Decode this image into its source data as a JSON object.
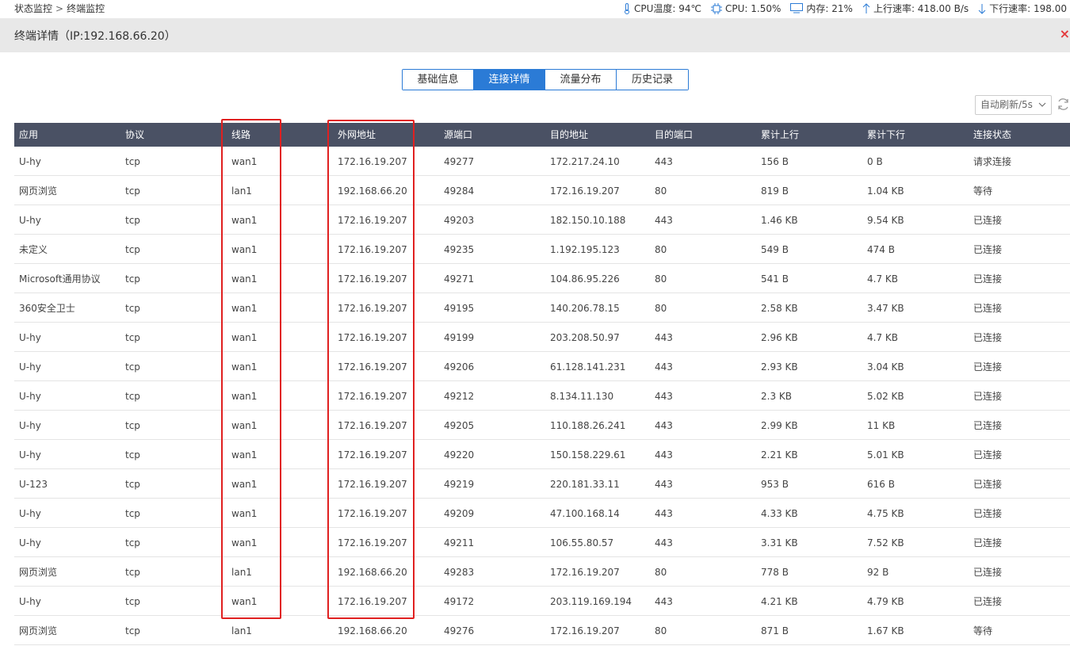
{
  "breadcrumb": {
    "parent": "状态监控",
    "separator": ">",
    "current": "终端监控"
  },
  "stats": {
    "cpu_temp": "CPU温度: 94℃",
    "cpu": "CPU: 1.50%",
    "memory": "内存: 21%",
    "upload": "上行速率: 418.00 B/s",
    "download": "下行速率: 198.00"
  },
  "panel": {
    "title": "终端详情（IP:192.168.66.20）",
    "close": "×"
  },
  "tabs": [
    {
      "label": "基础信息",
      "active": false
    },
    {
      "label": "连接详情",
      "active": true
    },
    {
      "label": "流量分布",
      "active": false
    },
    {
      "label": "历史记录",
      "active": false
    }
  ],
  "refresh": {
    "value": "自动刷新/5s"
  },
  "table": {
    "headers": [
      "应用",
      "协议",
      "线路",
      "外网地址",
      "源端口",
      "目的地址",
      "目的端口",
      "累计上行",
      "累计下行",
      "连接状态"
    ],
    "rows": [
      [
        "U-hy",
        "tcp",
        "wan1",
        "172.16.19.207",
        "49277",
        "172.217.24.10",
        "443",
        "156 B",
        "0 B",
        "请求连接"
      ],
      [
        "网页浏览",
        "tcp",
        "lan1",
        "192.168.66.20",
        "49284",
        "172.16.19.207",
        "80",
        "819 B",
        "1.04 KB",
        "等待"
      ],
      [
        "U-hy",
        "tcp",
        "wan1",
        "172.16.19.207",
        "49203",
        "182.150.10.188",
        "443",
        "1.46 KB",
        "9.54 KB",
        "已连接"
      ],
      [
        "未定义",
        "tcp",
        "wan1",
        "172.16.19.207",
        "49235",
        "1.192.195.123",
        "80",
        "549 B",
        "474 B",
        "已连接"
      ],
      [
        "Microsoft通用协议",
        "tcp",
        "wan1",
        "172.16.19.207",
        "49271",
        "104.86.95.226",
        "80",
        "541 B",
        "4.7 KB",
        "已连接"
      ],
      [
        "360安全卫士",
        "tcp",
        "wan1",
        "172.16.19.207",
        "49195",
        "140.206.78.15",
        "80",
        "2.58 KB",
        "3.47 KB",
        "已连接"
      ],
      [
        "U-hy",
        "tcp",
        "wan1",
        "172.16.19.207",
        "49199",
        "203.208.50.97",
        "443",
        "2.96 KB",
        "4.7 KB",
        "已连接"
      ],
      [
        "U-hy",
        "tcp",
        "wan1",
        "172.16.19.207",
        "49206",
        "61.128.141.231",
        "443",
        "2.93 KB",
        "3.04 KB",
        "已连接"
      ],
      [
        "U-hy",
        "tcp",
        "wan1",
        "172.16.19.207",
        "49212",
        "8.134.11.130",
        "443",
        "2.3 KB",
        "5.02 KB",
        "已连接"
      ],
      [
        "U-hy",
        "tcp",
        "wan1",
        "172.16.19.207",
        "49205",
        "110.188.26.241",
        "443",
        "2.99 KB",
        "11 KB",
        "已连接"
      ],
      [
        "U-hy",
        "tcp",
        "wan1",
        "172.16.19.207",
        "49220",
        "150.158.229.61",
        "443",
        "2.21 KB",
        "5.01 KB",
        "已连接"
      ],
      [
        "U-123",
        "tcp",
        "wan1",
        "172.16.19.207",
        "49219",
        "220.181.33.11",
        "443",
        "953 B",
        "616 B",
        "已连接"
      ],
      [
        "U-hy",
        "tcp",
        "wan1",
        "172.16.19.207",
        "49209",
        "47.100.168.14",
        "443",
        "4.33 KB",
        "4.75 KB",
        "已连接"
      ],
      [
        "U-hy",
        "tcp",
        "wan1",
        "172.16.19.207",
        "49211",
        "106.55.80.57",
        "443",
        "3.31 KB",
        "7.52 KB",
        "已连接"
      ],
      [
        "网页浏览",
        "tcp",
        "lan1",
        "192.168.66.20",
        "49283",
        "172.16.19.207",
        "80",
        "778 B",
        "92 B",
        "已连接"
      ],
      [
        "U-hy",
        "tcp",
        "wan1",
        "172.16.19.207",
        "49172",
        "203.119.169.194",
        "443",
        "4.21 KB",
        "4.79 KB",
        "已连接"
      ],
      [
        "网页浏览",
        "tcp",
        "lan1",
        "192.168.66.20",
        "49276",
        "172.16.19.207",
        "80",
        "871 B",
        "1.67 KB",
        "等待"
      ]
    ]
  },
  "colors": {
    "accent": "#2b7bd6",
    "header_bg": "#4a5164",
    "highlight": "#e02020",
    "close": "#e4393c"
  }
}
